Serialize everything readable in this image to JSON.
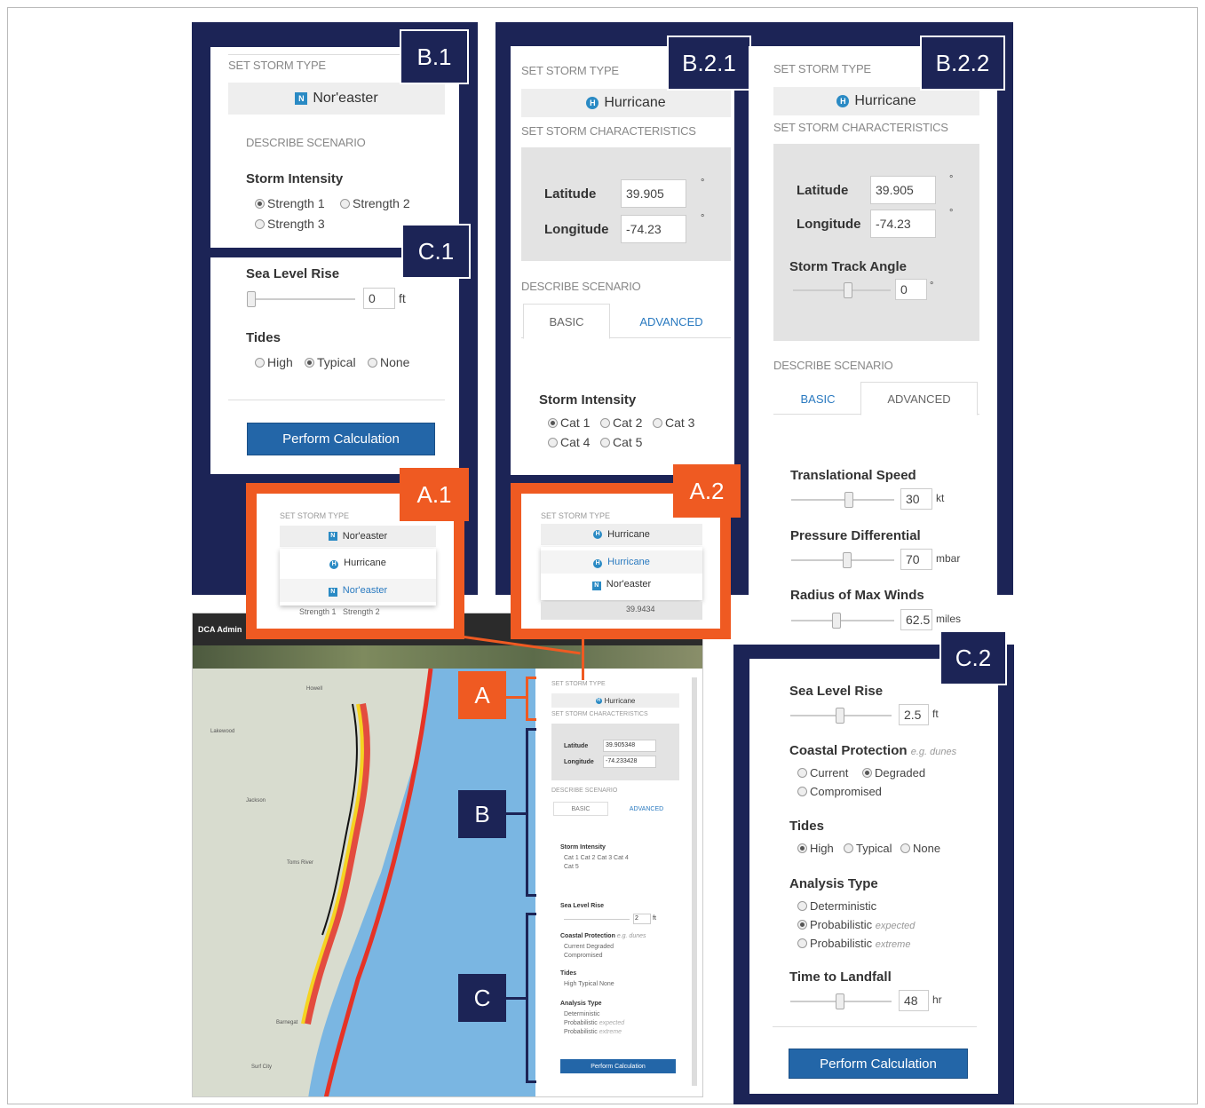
{
  "labels": {
    "b1": "B.1",
    "b21": "B.2.1",
    "b22": "B.2.2",
    "c1": "C.1",
    "c2": "C.2",
    "a1": "A.1",
    "a2": "A.2",
    "a": "A",
    "b": "B",
    "c": "C"
  },
  "b1": {
    "set_storm_type": "SET STORM TYPE",
    "storm_type": "Nor'easter",
    "describe": "DESCRIBE SCENARIO",
    "intensity_label": "Storm Intensity",
    "strengths": [
      "Strength 1",
      "Strength 2",
      "Strength 3"
    ],
    "selected": "Strength 1"
  },
  "c1": {
    "slr_label": "Sea Level Rise",
    "slr_value": "0",
    "slr_unit": "ft",
    "tides_label": "Tides",
    "tides": [
      "High",
      "Typical",
      "None"
    ],
    "tides_selected": "Typical",
    "button": "Perform Calculation"
  },
  "a1": {
    "set_storm_type": "SET STORM TYPE",
    "selected": "Nor'easter",
    "options": [
      "Hurricane",
      "Nor'easter"
    ],
    "below": [
      "Strength 1",
      "Strength 2"
    ]
  },
  "b21": {
    "set_storm_type": "SET STORM TYPE",
    "storm_type": "Hurricane",
    "set_char": "SET STORM CHARACTERISTICS",
    "lat_label": "Latitude",
    "lat": "39.905",
    "lon_label": "Longitude",
    "lon": "-74.23",
    "deg": "°",
    "describe": "DESCRIBE SCENARIO",
    "tab_basic": "BASIC",
    "tab_adv": "ADVANCED",
    "intensity_label": "Storm Intensity",
    "cats": [
      "Cat 1",
      "Cat 2",
      "Cat 3",
      "Cat 4",
      "Cat 5"
    ],
    "selected": "Cat 1"
  },
  "a2": {
    "set_storm_type": "SET STORM TYPE",
    "selected": "Hurricane",
    "options": [
      "Hurricane",
      "Nor'easter"
    ],
    "below": "39.9434"
  },
  "b22": {
    "set_storm_type": "SET STORM TYPE",
    "storm_type": "Hurricane",
    "set_char": "SET STORM CHARACTERISTICS",
    "lat_label": "Latitude",
    "lat": "39.905",
    "lon_label": "Longitude",
    "lon": "-74.23",
    "deg": "°",
    "angle_label": "Storm Track Angle",
    "angle": "0",
    "describe": "DESCRIBE SCENARIO",
    "tab_basic": "BASIC",
    "tab_adv": "ADVANCED",
    "speed_label": "Translational Speed",
    "speed": "30",
    "speed_unit": "kt",
    "pressure_label": "Pressure Differential",
    "pressure": "70",
    "pressure_unit": "mbar",
    "radius_label": "Radius of Max Winds",
    "radius": "62.5",
    "radius_unit": "miles"
  },
  "c2": {
    "slr_label": "Sea Level Rise",
    "slr_value": "2.5",
    "slr_unit": "ft",
    "cp_label": "Coastal Protection",
    "cp_hint": "e.g. dunes",
    "cp": [
      "Current",
      "Degraded",
      "Compromised"
    ],
    "cp_selected": "Degraded",
    "tides_label": "Tides",
    "tides": [
      "High",
      "Typical",
      "None"
    ],
    "tides_selected": "High",
    "analysis_label": "Analysis Type",
    "analysis": [
      "Deterministic",
      "Probabilistic",
      "Probabilistic"
    ],
    "analysis_hints": [
      "",
      "expected",
      "extreme"
    ],
    "analysis_selected": "Probabilistic",
    "ttl_label": "Time to Landfall",
    "ttl": "48",
    "ttl_unit": "hr",
    "button": "Perform Calculation"
  },
  "app": {
    "header": "DCA Admin",
    "set_storm_type": "SET STORM TYPE",
    "storm_type": "Hurricane",
    "set_char": "SET STORM CHARACTERISTICS",
    "lat_label": "Latitude",
    "lat": "39.905348",
    "lon_label": "Longitude",
    "lon": "-74.233428",
    "describe": "DESCRIBE SCENARIO",
    "tab_basic": "BASIC",
    "tab_adv": "ADVANCED",
    "intensity_label": "Storm Intensity",
    "cats": "Cat 1  Cat 2  Cat 3  Cat 4",
    "cat5": "Cat 5",
    "slr_label": "Sea Level Rise",
    "slr": "2",
    "slr_unit": "ft",
    "cp_label": "Coastal Protection",
    "cp_hint": "e.g. dunes",
    "cp_line": "Current  Degraded",
    "cp_line2": "Compromised",
    "tides_label": "Tides",
    "tides_line": "High  Typical  None",
    "analysis_label": "Analysis Type",
    "an1": "Deterministic",
    "an2": "Probabilistic",
    "an2h": "expected",
    "an3": "Probabilistic",
    "an3h": "extreme",
    "button": "Perform Calculation",
    "map_places": [
      "Howell",
      "Lakewood",
      "Jackson",
      "Toms River",
      "Barnegat",
      "Surf City"
    ]
  },
  "colors": {
    "navy": "#1c2456",
    "orange": "#ef5a22",
    "button": "#2366a8",
    "water": "#7ab6e2"
  }
}
